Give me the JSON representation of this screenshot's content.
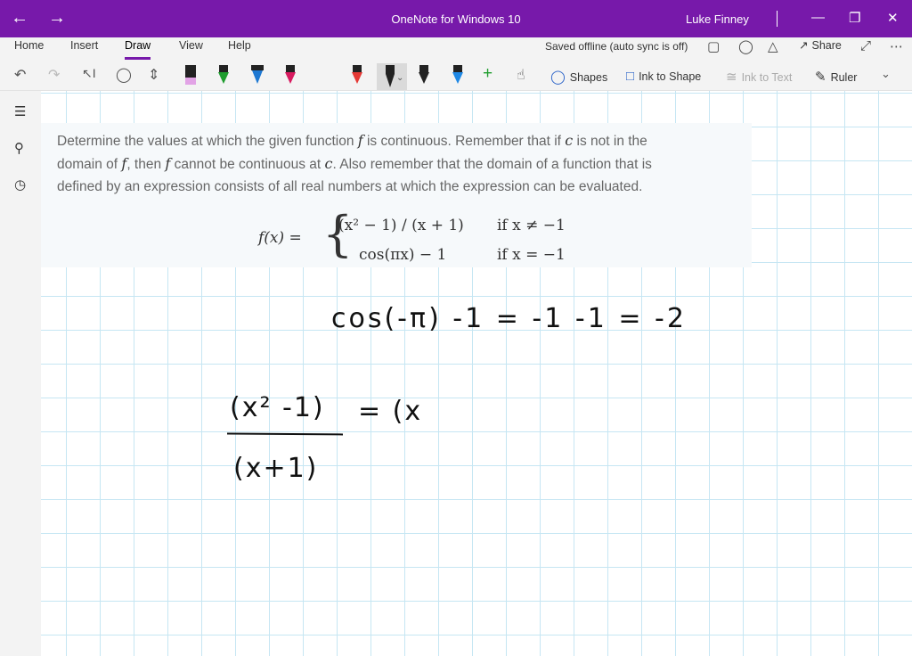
{
  "titlebar": {
    "app_title": "OneNote for Windows 10",
    "user": "Luke Finney"
  },
  "ribbon": {
    "tabs": [
      {
        "label": "Home",
        "active": false
      },
      {
        "label": "Insert",
        "active": false
      },
      {
        "label": "Draw",
        "active": true
      },
      {
        "label": "View",
        "active": false
      },
      {
        "label": "Help",
        "active": false
      }
    ],
    "sync_status": "Saved offline (auto sync is off)",
    "share_label": "Share"
  },
  "toolbar": {
    "pens": [
      {
        "color": "#e2a3e6"
      },
      {
        "color": "#1f9d2e"
      },
      {
        "color": "#1e78d2"
      },
      {
        "color": "#d81b60"
      },
      {
        "color": "#e53935"
      },
      {
        "color": "#222222"
      },
      {
        "color": "#222222"
      },
      {
        "color": "#1e88e5"
      }
    ],
    "shapes_label": "Shapes",
    "ink_to_shape_label": "Ink to Shape",
    "ink_to_text_label": "Ink to Text",
    "ruler_label": "Ruler"
  },
  "problem": {
    "line1_a": "Determine the values at which the given function ",
    "line1_f": "f",
    "line1_b": " is continuous. Remember that if ",
    "line1_c": "c",
    "line1_d": " is not in the",
    "line2_a": "domain of ",
    "line2_f": "f",
    "line2_b": ", then ",
    "line2_f2": "f",
    "line2_c": " cannot be continuous at ",
    "line2_cc": "c",
    "line2_d": ". Also remember that the domain of a function that is",
    "line3": "defined by an expression consists of all real numbers at which the expression can be evaluated."
  },
  "formula": {
    "lhs": "f(x) =",
    "case1_expr": "(x² − 1) / (x + 1)",
    "case1_cond": "if x ≠ −1",
    "case2_expr": "cos(πx) − 1",
    "case2_cond": "if x = −1"
  },
  "handwriting": {
    "line1": "cos(-π) -1 = -1 -1 = -2",
    "numerator": "(x² -1)",
    "equals_part": "= (x",
    "denominator": "(x+1)"
  },
  "colors": {
    "accent": "#7719aa",
    "grid": "#c6e6f3"
  }
}
